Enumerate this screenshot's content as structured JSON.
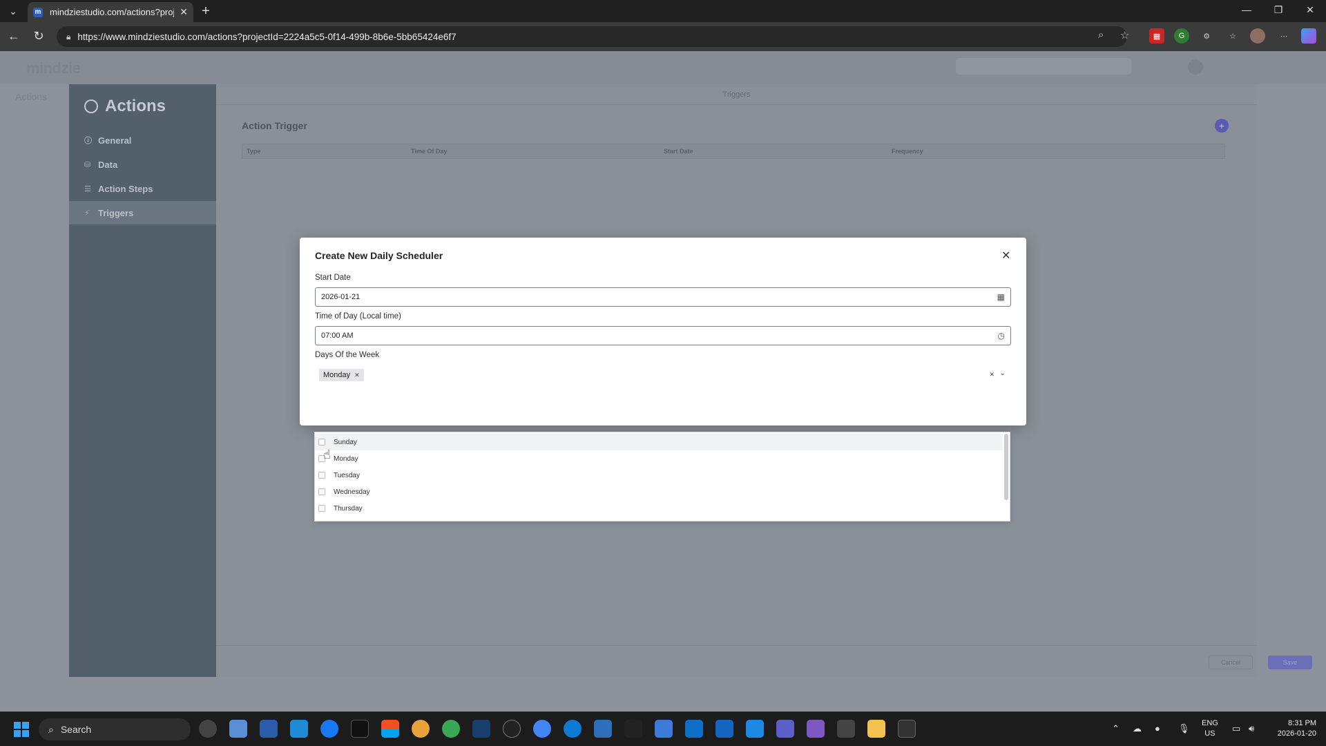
{
  "browser": {
    "tab_title": "mindziestudio.com/actions?proje",
    "favicon_letter": "m",
    "url": "https://www.mindziestudio.com/actions?projectId=2224a5c5-0f14-499b-8b6e-5bb65424e6f7"
  },
  "app": {
    "logo": "mindzie",
    "side_label": "Actions",
    "nav_title": "Actions",
    "nav_items": [
      {
        "label": "General",
        "icon": "info-icon"
      },
      {
        "label": "Data",
        "icon": "data-icon"
      },
      {
        "label": "Action Steps",
        "icon": "steps-icon"
      },
      {
        "label": "Triggers",
        "icon": "bolt-icon"
      }
    ],
    "content_tab": "Triggers",
    "section_title": "Action Trigger",
    "grid_columns": [
      "Type",
      "Time Of Day",
      "Start Date",
      "Frequency"
    ],
    "cancel_label": "Cancel",
    "save_label": "Save"
  },
  "modal": {
    "title": "Create New Daily Scheduler",
    "start_date_label": "Start Date",
    "start_date_value": "2026-01-21",
    "time_label": "Time of Day (Local time)",
    "time_value": "07:00 AM",
    "days_label": "Days Of the Week",
    "selected_days": [
      "Monday"
    ],
    "options": [
      "Sunday",
      "Monday",
      "Tuesday",
      "Wednesday",
      "Thursday"
    ]
  },
  "taskbar": {
    "search_placeholder": "Search",
    "lang_top": "ENG",
    "lang_bottom": "US",
    "time": "8:31 PM",
    "date": "2026-01-20"
  },
  "colors": {
    "accent": "#5a5cb3",
    "sidebar": "#535f6b",
    "overlay_bg": "#8b929c"
  }
}
